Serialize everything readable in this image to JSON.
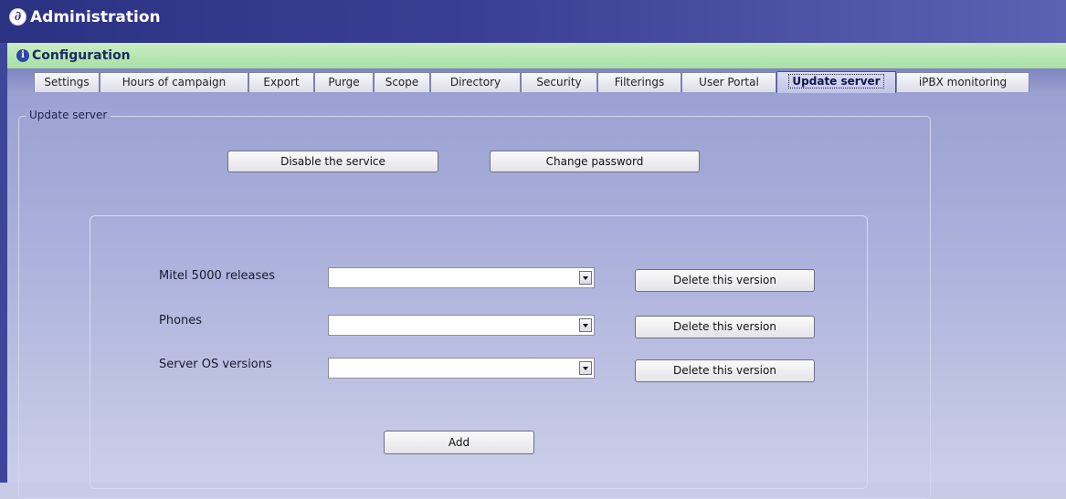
{
  "window": {
    "title": "Administration",
    "icon": "app-logo-icon"
  },
  "section": {
    "title": "Configuration",
    "icon": "info-icon"
  },
  "tabs": [
    {
      "label": "Settings"
    },
    {
      "label": "Hours of campaign"
    },
    {
      "label": "Export"
    },
    {
      "label": "Purge"
    },
    {
      "label": "Scope"
    },
    {
      "label": "Directory"
    },
    {
      "label": "Security"
    },
    {
      "label": "Filterings"
    },
    {
      "label": "User Portal"
    },
    {
      "label": "Update server",
      "active": true
    },
    {
      "label": "iPBX monitoring"
    }
  ],
  "update_server": {
    "group_label": "Update server",
    "disable_button": "Disable the service",
    "change_password_button": "Change password",
    "rows": [
      {
        "label": "Mitel 5000 releases",
        "value": "",
        "delete_button": "Delete this version"
      },
      {
        "label": "Phones",
        "value": "",
        "delete_button": "Delete this version"
      },
      {
        "label": "Server OS versions",
        "value": "",
        "delete_button": "Delete this version"
      }
    ],
    "add_button": "Add"
  },
  "colors": {
    "title_bar": "#2b3282",
    "config_bar": "#b8e6b4",
    "panel_bg": "#adb3dc",
    "active_tab": "#c8ccef"
  }
}
